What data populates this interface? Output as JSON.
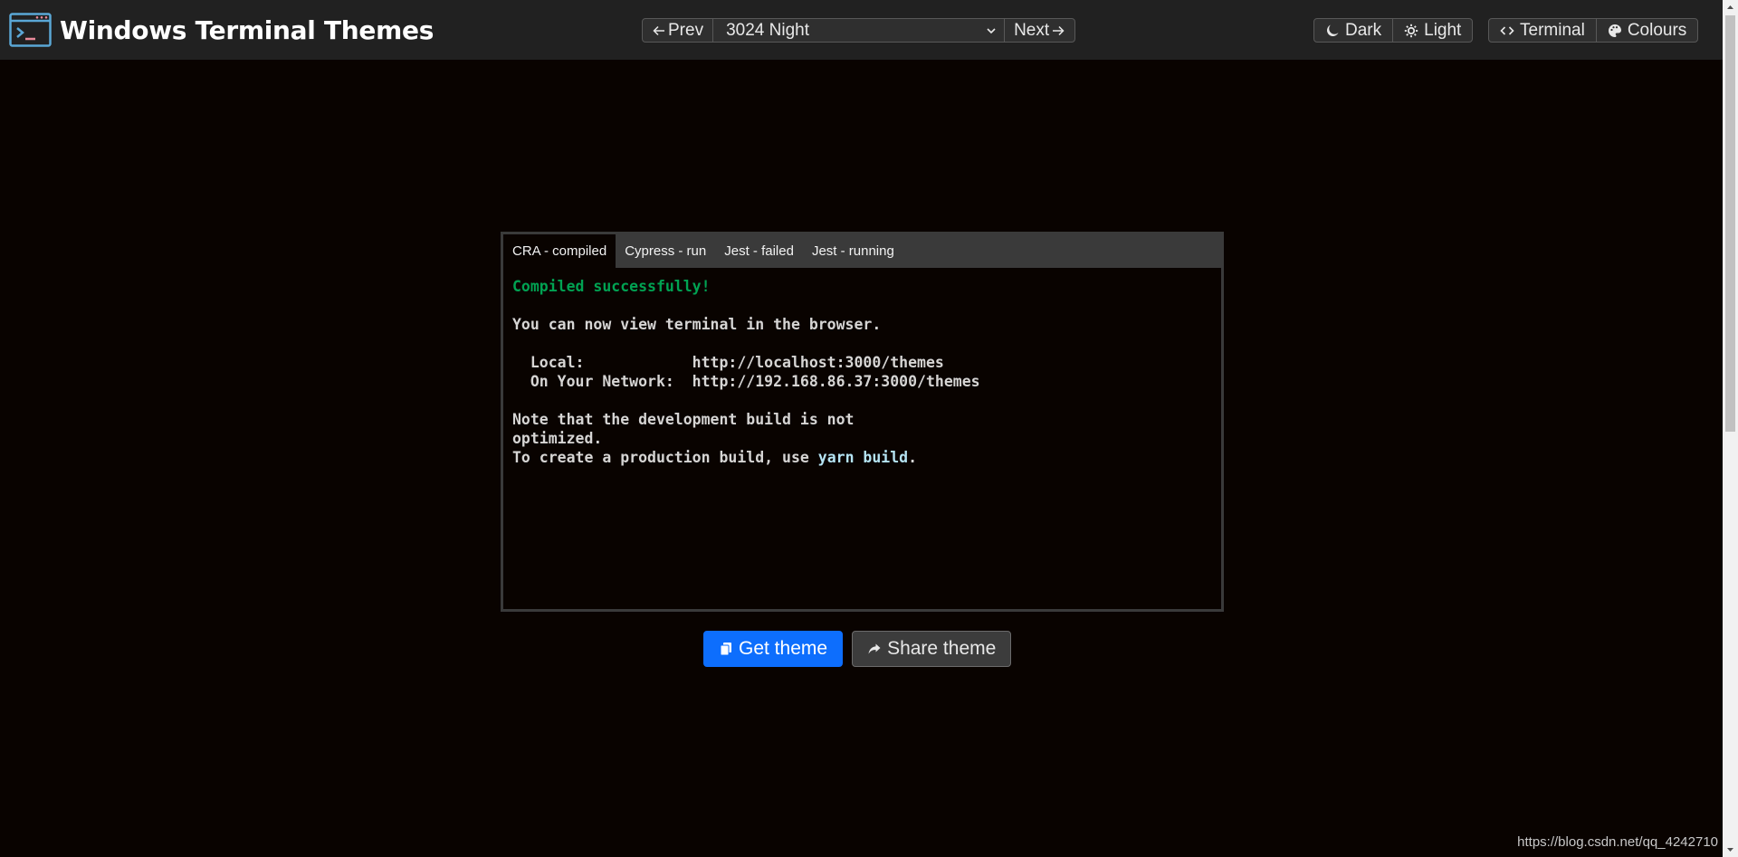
{
  "header": {
    "title": "Windows Terminal Themes",
    "prev_label": "Prev",
    "next_label": "Next",
    "theme_select_value": "3024 Night",
    "dark_label": "Dark",
    "light_label": "Light",
    "terminal_label": "Terminal",
    "colours_label": "Colours"
  },
  "terminal": {
    "tabs": [
      {
        "label": "CRA - compiled"
      },
      {
        "label": "Cypress - run"
      },
      {
        "label": "Jest - failed"
      },
      {
        "label": "Jest - running"
      }
    ],
    "lines": {
      "l1": "Compiled successfully!",
      "l2": "You can now view terminal in the browser.",
      "l3": "  Local:            http://localhost:3000/themes",
      "l4": "  On Your Network:  http://192.168.86.37:3000/themes",
      "l5": "Note that the development build is not",
      "l6": "optimized.",
      "l7a": "To create a production build, use ",
      "l7b": "yarn build",
      "l7c": "."
    }
  },
  "actions": {
    "get_theme_label": "Get theme",
    "share_theme_label": "Share theme"
  },
  "watermark": "https://blog.csdn.net/qq_4242710",
  "colors": {
    "background": "#090300",
    "terminal_green": "#01a252",
    "primary": "#0d6efd"
  }
}
